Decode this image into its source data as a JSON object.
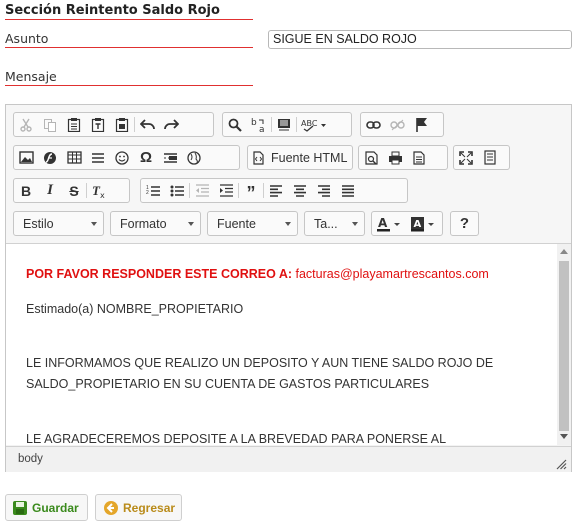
{
  "section_title": "Sección Reintento Saldo Rojo",
  "fields": {
    "subject_label": "Asunto",
    "subject_value": "SIGUE EN SALDO ROJO",
    "message_label": "Mensaje"
  },
  "toolbar": {
    "row1": [
      "cut-icon",
      "copy-icon",
      "paste-icon",
      "paste-text-icon",
      "paste-word-icon",
      "undo-icon",
      "redo-icon",
      "find-icon",
      "replace-icon",
      "select-all-icon",
      "spellcheck-icon",
      "link-icon",
      "unlink-icon",
      "anchor-icon"
    ],
    "source_label": "Fuente HTML",
    "style_combo": "Estilo",
    "format_combo": "Formato",
    "font_combo": "Fuente",
    "size_combo": "Ta...",
    "help_label": "?"
  },
  "content": {
    "line1_prefix": "POR FAVOR RESPONDER ESTE CORREO A:",
    "line1_email": "facturas@playamartrescantos.com",
    "line2": "Estimado(a)  NOMBRE_PROPIETARIO",
    "line3a": "LE INFORMAMOS QUE REALIZO UN DEPOSITO Y AUN TIENE SALDO ROJO DE",
    "line3b": "SALDO_PROPIETARIO EN SU CUENTA DE GASTOS PARTICULARES",
    "line4": "LE AGRADECEREMOS DEPOSITE A LA BREVEDAD PARA PONERSE AL"
  },
  "statusbar": {
    "path": "body"
  },
  "actions": {
    "save_label": "Guardar",
    "back_label": "Regresar"
  },
  "colors": {
    "accent_red": "#e01010",
    "underline_red": "#e03030",
    "save_green": "#3a8a1c",
    "back_gold": "#b98b1a"
  }
}
